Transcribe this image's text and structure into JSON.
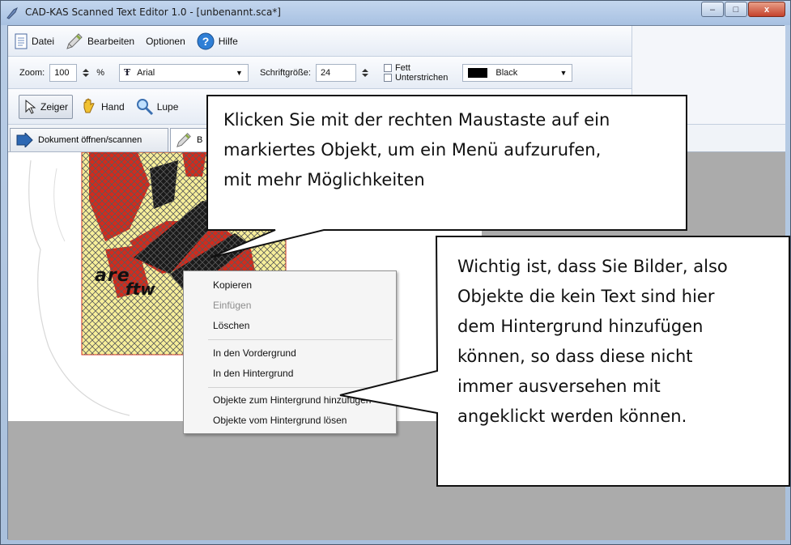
{
  "window": {
    "title": "CAD-KAS Scanned Text Editor 1.0 - [unbenannt.sca*]",
    "controls": {
      "minimize": "–",
      "maximize": "□",
      "close": "x"
    }
  },
  "menu": {
    "items": [
      {
        "label": "Datei",
        "icon": "document-icon"
      },
      {
        "label": "Bearbeiten",
        "icon": "edit-pen-icon"
      },
      {
        "label": "Optionen",
        "icon": ""
      },
      {
        "label": "Hilfe",
        "icon": "help-icon"
      }
    ]
  },
  "format_bar": {
    "zoom_label": "Zoom:",
    "zoom_value": "100",
    "zoom_unit": "%",
    "font_name": "Arial",
    "font_size_label": "Schriftgröße:",
    "font_size_value": "24",
    "bold_label": "Fett",
    "underline_label": "Unterstrichen",
    "color_label": "Black",
    "color_hex": "#000000"
  },
  "tools": {
    "pointer": "Zeiger",
    "hand": "Hand",
    "magnifier": "Lupe"
  },
  "tabs": {
    "open_scan": "Dokument öffnen/scannen",
    "edit_short": "B"
  },
  "canvas": {
    "caption": "are",
    "logo_text": "ftw"
  },
  "context_menu": {
    "copy": "Kopieren",
    "paste": "Einfügen",
    "delete": "Löschen",
    "bring_front": "In den Vordergrund",
    "send_back": "In den Hintergrund",
    "add_to_background": "Objekte zum Hintergrund hinzufügen",
    "remove_from_background": "Objekte vom Hintergrund lösen"
  },
  "callouts": {
    "top": [
      "Klicken Sie mit der rechten Maustaste auf ein",
      "markiertes Objekt, um ein Menü aufzurufen,",
      "mit mehr Möglichkeiten"
    ],
    "right": [
      "Wichtig ist, dass Sie Bilder, also",
      "Objekte die kein Text sind hier",
      "dem Hintergrund hinzufügen",
      "können, so dass diese nicht",
      "immer ausversehen mit",
      "angeklickt werden können."
    ]
  },
  "colors": {
    "logo_red": "#d32a1c",
    "logo_yellow": "#f7ef9a",
    "canvas_gray": "#ababab"
  }
}
